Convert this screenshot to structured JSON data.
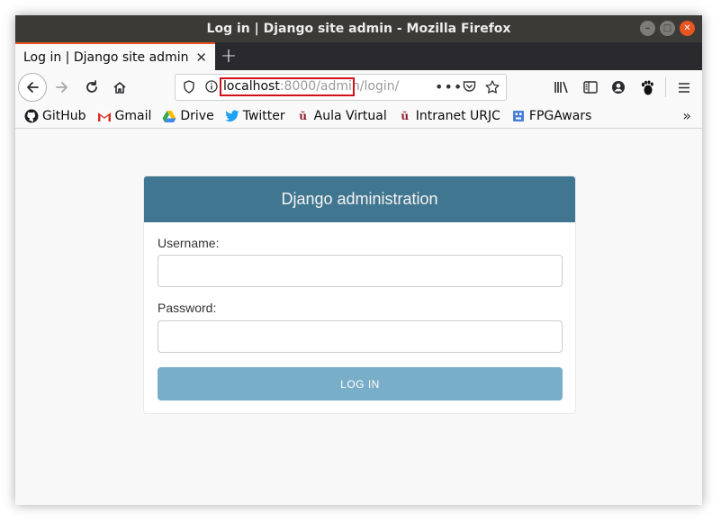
{
  "window": {
    "title": "Log in | Django site admin - Mozilla Firefox",
    "tab_title": "Log in | Django site admin"
  },
  "urlbar": {
    "host": "localhost",
    "path_highlight": ":8000/admin",
    "path_rest": "/login/?"
  },
  "bookmarks": [
    {
      "label": "GitHub",
      "icon": "github-icon"
    },
    {
      "label": "Gmail",
      "icon": "gmail-icon"
    },
    {
      "label": "Drive",
      "icon": "drive-icon"
    },
    {
      "label": "Twitter",
      "icon": "twitter-icon"
    },
    {
      "label": "Aula Virtual",
      "icon": "urjc-icon"
    },
    {
      "label": "Intranet URJC",
      "icon": "urjc-icon"
    },
    {
      "label": "FPGAwars",
      "icon": "fpgawars-icon"
    }
  ],
  "login": {
    "header": "Django administration",
    "username_label": "Username:",
    "password_label": "Password:",
    "submit_label": "LOG IN"
  },
  "colors": {
    "django_header": "#417690",
    "login_button": "#79aec8",
    "tab_accent": "#e95420",
    "url_highlight_border": "#d0101a"
  }
}
